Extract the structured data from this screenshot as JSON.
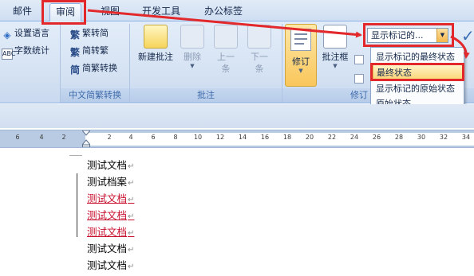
{
  "ribbon": {
    "tabs": [
      "邮件",
      "审阅",
      "视图",
      "开发工具",
      "办公标签"
    ],
    "active_tab": "审阅",
    "language_group": {
      "items": [
        "设置语言",
        "字数统计"
      ]
    },
    "chinese_group": {
      "label": "中文简繁转换",
      "items": [
        "繁转简",
        "简转繁",
        "简繁转换"
      ]
    },
    "comments_group": {
      "label": "批注",
      "buttons": [
        "新建批注",
        "删除",
        "上一\n条",
        "下一\n条"
      ]
    },
    "tracking_group": {
      "label": "修订",
      "track_changes": "修订",
      "balloons": "批注框",
      "display_combo": "显示标记的..."
    }
  },
  "display_menu": {
    "items": [
      "显示标记的最终状态",
      "最终状态",
      "显示标记的原始状态",
      "原始状态"
    ],
    "selected": "最终状态"
  },
  "ruler": {
    "ticks": [
      "6",
      "4",
      "2",
      "2",
      "4",
      "6",
      "8",
      "10",
      "12",
      "14",
      "16",
      "18",
      "20",
      "22",
      "24",
      "26",
      "28",
      "30",
      "32",
      "34"
    ]
  },
  "document": {
    "paragraph_mark": "↵",
    "lines": [
      {
        "text": "测试文档",
        "changed": false
      },
      {
        "text": "测试档案",
        "changed": false
      },
      {
        "text": "测试文档",
        "changed": true
      },
      {
        "text": "测试文档",
        "changed": true
      },
      {
        "text": "测试文档",
        "changed": true
      },
      {
        "text": "测试文档",
        "changed": false
      },
      {
        "text": "测试文档",
        "changed": false
      }
    ]
  },
  "colors": {
    "annotation_red": "#e2282a",
    "change_text": "#c8102e",
    "ribbon_bg": "#d6e3f3",
    "highlight": "#fbd87a"
  }
}
